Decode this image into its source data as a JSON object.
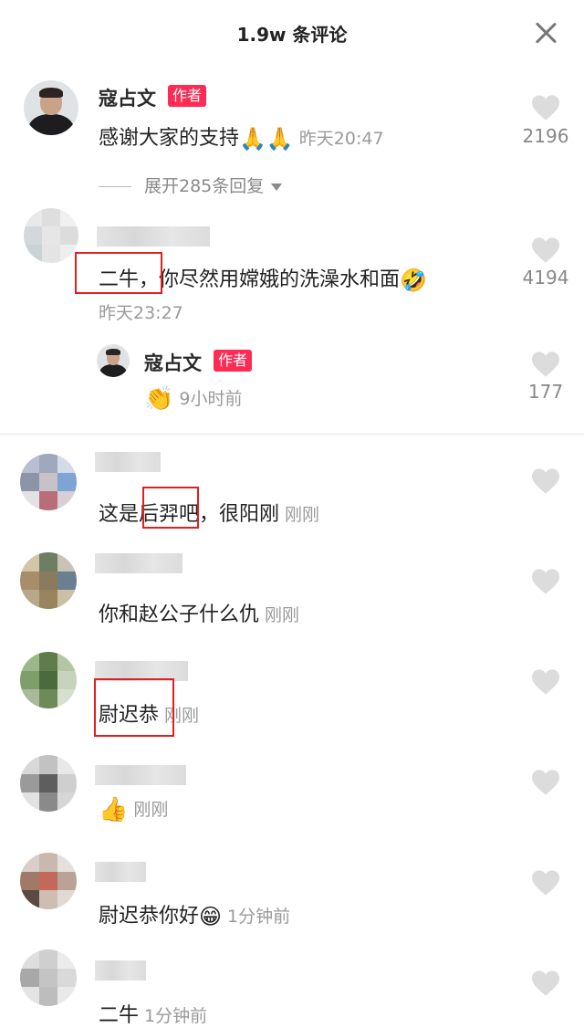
{
  "header": {
    "title": "1.9w 条评论"
  },
  "comments": [
    {
      "username": "寇占文",
      "badge": "作者",
      "text": "感谢大家的支持",
      "emoji": "🙏🙏",
      "time": "昨天20:47",
      "likes": "2196",
      "expand": "展开285条回复"
    },
    {
      "text": "二牛，你尽然用嫦娥的洗澡水和面",
      "emoji": "🤣",
      "time": "昨天23:27",
      "likes": "4194",
      "reply": {
        "username": "寇占文",
        "badge": "作者",
        "emoji": "👏",
        "time": "9小时前",
        "likes": "177"
      }
    },
    {
      "text": "这是后羿吧，很阳刚",
      "time": "刚刚"
    },
    {
      "text": "你和赵公子什么仇",
      "time": "刚刚"
    },
    {
      "text": "尉迟恭",
      "time": "刚刚"
    },
    {
      "emoji": "👍",
      "time": "刚刚"
    },
    {
      "text": "尉迟恭你好",
      "emoji": "😁",
      "time": "1分钟前"
    },
    {
      "text": "二牛",
      "time": "1分钟前"
    }
  ],
  "colors": {
    "badge": "#fe2c55",
    "highlight_box": "#e02020",
    "muted": "#9a9a9a"
  }
}
